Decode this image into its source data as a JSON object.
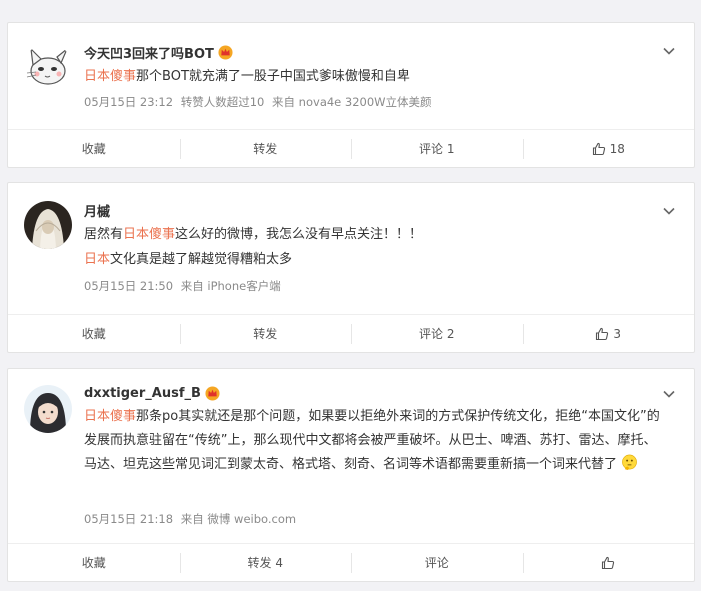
{
  "colors": {
    "accent": "#eb7350",
    "muted": "#8a8a8a",
    "text": "#333333"
  },
  "posts": [
    {
      "author": "今天凹3回来了吗BOT",
      "avatar_icon": "cat-avatar",
      "badge_icon": "crown-badge-icon",
      "lines": [
        {
          "hl": "日本傻事",
          "rest": "那个BOT就充满了一股子中国式爹味傲慢和自卑"
        }
      ],
      "time": "05月15日 23:12",
      "extra": "转赞人数超过10",
      "source": "来自 nova4e 3200W立体美颜",
      "actions": {
        "fav": "收藏",
        "repost": "转发",
        "comment": "评论 1",
        "like_count": "18"
      }
    },
    {
      "author": "月槭",
      "avatar_icon": "hooded-figure-avatar",
      "lines": [
        {
          "pre": "居然有",
          "hl": "日本傻事",
          "rest": "这么好的微博，我怎么没有早点关注！！！"
        },
        {
          "hl": "日本",
          "rest": "文化真是越了解越觉得糟粕太多"
        }
      ],
      "time": "05月15日 21:50",
      "source": "来自 iPhone客户端",
      "actions": {
        "fav": "收藏",
        "repost": "转发",
        "comment": "评论 2",
        "like_count": "3"
      }
    },
    {
      "author": "dxxtiger_Ausf_B",
      "avatar_icon": "girl-portrait-avatar",
      "badge_icon": "crown-badge-icon",
      "hl": "日本傻事",
      "text": "那条po其实就还是那个问题，如果要以拒绝外来词的方式保护传统文化，拒绝“本国文化”的发展而执意驻留在“传统”上，那么现代中文都将会被严重破坏。从巴士、啤酒、苏打、雷达、摩托、马达、坦克这些常见词汇到蒙太奇、格式塔、刻奇、名词等术语都需要重新搞一个词来代替了",
      "emoji_icon": "thinking-face-emoji",
      "time": "05月15日 21:18",
      "source": "来自 微博 weibo.com",
      "actions": {
        "fav": "收藏",
        "repost": "转发 4",
        "comment": "评论"
      }
    }
  ]
}
